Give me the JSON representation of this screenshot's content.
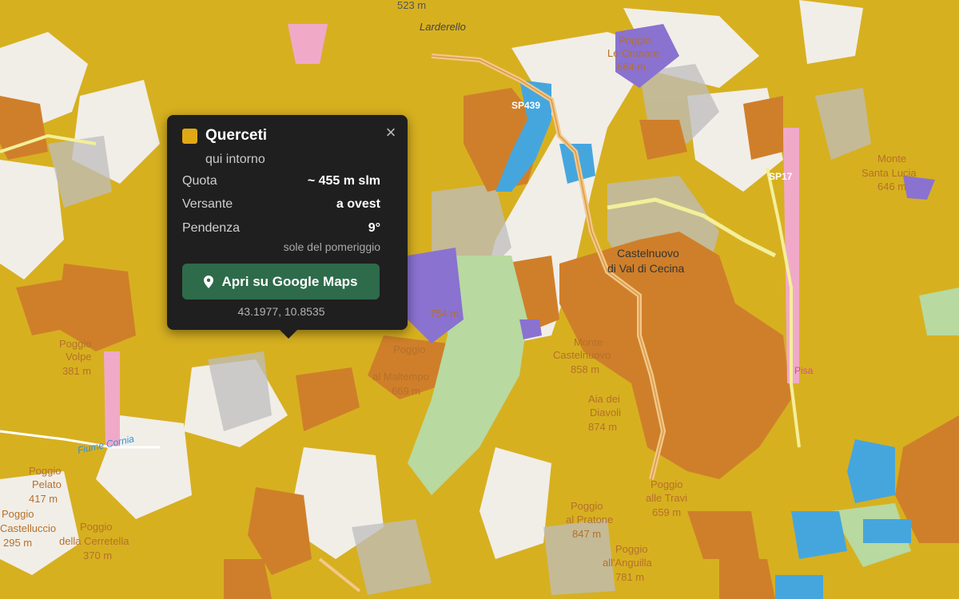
{
  "map": {
    "colors": {
      "oak": "#d7b020",
      "chestnut": "#cf7f2a",
      "pine": "#8fcf98",
      "conifer_mixed": "#cfd6a0",
      "water": "#45a6de",
      "purple": "#8a72d0",
      "urban": "#f1eee8",
      "shade": "#bdbdbd",
      "road": "#f2c889",
      "pink": "#f1a9c8"
    },
    "labels": [
      {
        "id": "ele-523",
        "text": "523 m"
      },
      {
        "id": "larderello",
        "text": "Larderello"
      },
      {
        "id": "poggio-top",
        "text": "Poggio"
      },
      {
        "id": "le-cranare",
        "text": "Le Cranare"
      },
      {
        "id": "ele-684",
        "text": "684 m"
      },
      {
        "id": "sp439",
        "text": "SP439"
      },
      {
        "id": "sp17",
        "text": "SP17"
      },
      {
        "id": "monte",
        "text": "Monte"
      },
      {
        "id": "santa-lucia",
        "text": "Santa Lucia"
      },
      {
        "id": "ele-646",
        "text": "646 m"
      },
      {
        "id": "castelnuovo-1",
        "text": "Castelnuovo"
      },
      {
        "id": "castelnuovo-2",
        "text": "di Val di Cecina"
      },
      {
        "id": "ele-754",
        "text": "754 m"
      },
      {
        "id": "poggio-left",
        "text": "Poggio"
      },
      {
        "id": "volpe",
        "text": "Volpe"
      },
      {
        "id": "ele-381",
        "text": "381 m"
      },
      {
        "id": "poggio-malt",
        "text": "Poggio"
      },
      {
        "id": "al-maltempo",
        "text": "al Maltempo"
      },
      {
        "id": "ele-669",
        "text": "669 m"
      },
      {
        "id": "monte-cast",
        "text": "Monte"
      },
      {
        "id": "castelnuovo-3",
        "text": "Castelnuovo"
      },
      {
        "id": "ele-858",
        "text": "858 m"
      },
      {
        "id": "aia-dei",
        "text": "Aia dei"
      },
      {
        "id": "diavoli",
        "text": "Diavoli"
      },
      {
        "id": "ele-874",
        "text": "874 m"
      },
      {
        "id": "fiume",
        "text": "Fiume Cornia"
      },
      {
        "id": "poggio-ll",
        "text": "Poggio"
      },
      {
        "id": "pelato",
        "text": "Pelato"
      },
      {
        "id": "ele-417",
        "text": "417 m"
      },
      {
        "id": "poggio-ll2",
        "text": "Poggio"
      },
      {
        "id": "castelluccio",
        "text": "Castelluccio"
      },
      {
        "id": "ele-295",
        "text": "295 m"
      },
      {
        "id": "poggio-cerr",
        "text": "Poggio"
      },
      {
        "id": "della-cerretella",
        "text": "della Cerretella"
      },
      {
        "id": "ele-370",
        "text": "370 m"
      },
      {
        "id": "poggio-prat",
        "text": "Poggio"
      },
      {
        "id": "al-pratone",
        "text": "al Pratone"
      },
      {
        "id": "ele-847",
        "text": "847 m"
      },
      {
        "id": "poggio-travi",
        "text": "Poggio"
      },
      {
        "id": "alle-travi",
        "text": "alle Travi"
      },
      {
        "id": "ele-659",
        "text": "659 m"
      },
      {
        "id": "poggio-ang",
        "text": "Poggio"
      },
      {
        "id": "all-anguilla",
        "text": "all'Anguilla"
      },
      {
        "id": "ele-781",
        "text": "781 m"
      },
      {
        "id": "pisa",
        "text": "Pisa"
      }
    ]
  },
  "popup": {
    "swatch_color": "#e0a814",
    "title": "Querceti",
    "subtitle": "qui intorno",
    "close_symbol": "×",
    "rows": [
      {
        "label": "Quota",
        "value": "~ 455 m slm"
      },
      {
        "label": "Versante",
        "value": "a ovest"
      },
      {
        "label": "Pendenza",
        "value": "9°"
      }
    ],
    "note": "sole del pomeriggio",
    "button_label": "Apri su Google Maps",
    "coords": "43.1977, 10.8535"
  }
}
